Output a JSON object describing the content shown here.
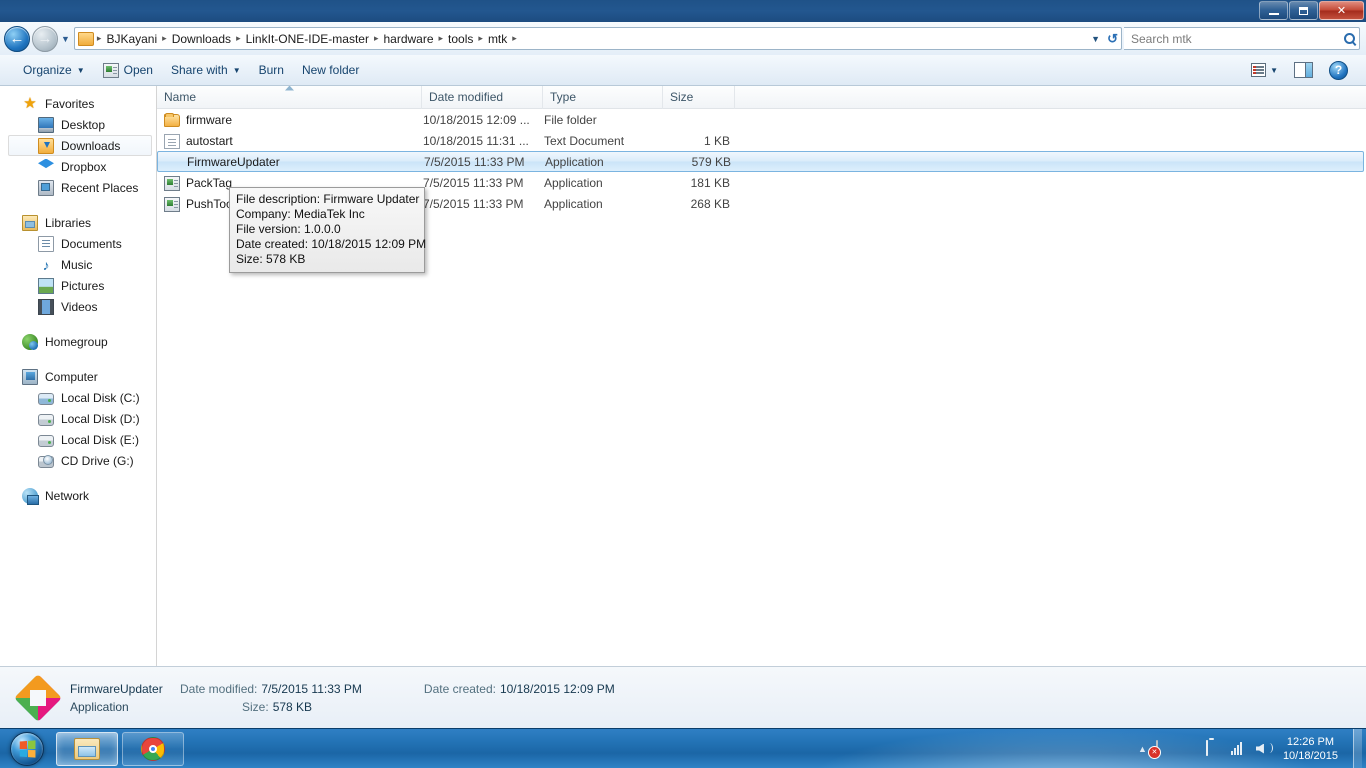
{
  "window": {
    "minimize_label": "Minimize",
    "maximize_label": "Maximize",
    "close_label": "Close"
  },
  "address": {
    "back_glyph": "←",
    "forward_glyph": "→",
    "history_caret": "▼",
    "crumbs": [
      "BJKayani",
      "Downloads",
      "LinkIt-ONE-IDE-master",
      "hardware",
      "tools",
      "mtk"
    ],
    "separator": "▸",
    "dropdown_caret": "▼",
    "refresh_glyph": "↺"
  },
  "search": {
    "placeholder": "Search mtk",
    "value": ""
  },
  "toolbar": {
    "organize_label": "Organize",
    "organize_caret": "▼",
    "open_label": "Open",
    "share_label": "Share with",
    "share_caret": "▼",
    "burn_label": "Burn",
    "new_folder_label": "New folder",
    "view_caret": "▼",
    "help_glyph": "?"
  },
  "sidebar": {
    "groups": [
      {
        "header": "Favorites",
        "items": [
          {
            "label": "Desktop",
            "selected": false
          },
          {
            "label": "Downloads",
            "selected": true
          },
          {
            "label": "Dropbox",
            "selected": false
          },
          {
            "label": "Recent Places",
            "selected": false
          }
        ]
      },
      {
        "header": "Libraries",
        "items": [
          {
            "label": "Documents",
            "selected": false
          },
          {
            "label": "Music",
            "selected": false
          },
          {
            "label": "Pictures",
            "selected": false
          },
          {
            "label": "Videos",
            "selected": false
          }
        ]
      },
      {
        "header": "Homegroup",
        "items": []
      },
      {
        "header": "Computer",
        "items": [
          {
            "label": "Local Disk (C:)",
            "selected": false
          },
          {
            "label": "Local Disk (D:)",
            "selected": false
          },
          {
            "label": "Local Disk (E:)",
            "selected": false
          },
          {
            "label": "CD Drive (G:)",
            "selected": false
          }
        ]
      },
      {
        "header": "Network",
        "items": []
      }
    ]
  },
  "file_list": {
    "columns": [
      "Name",
      "Date modified",
      "Type",
      "Size"
    ],
    "rows": [
      {
        "name": "firmware",
        "date": "10/18/2015 12:09 ...",
        "type": "File folder",
        "size": ""
      },
      {
        "name": "autostart",
        "date": "10/18/2015 11:31 ...",
        "type": "Text Document",
        "size": "1 KB"
      },
      {
        "name": "FirmwareUpdater",
        "date": "7/5/2015 11:33 PM",
        "type": "Application",
        "size": "579 KB"
      },
      {
        "name": "PackTag",
        "date": "7/5/2015 11:33 PM",
        "type": "Application",
        "size": "181 KB"
      },
      {
        "name": "PushTool",
        "date": "7/5/2015 11:33 PM",
        "type": "Application",
        "size": "268 KB"
      }
    ]
  },
  "tooltip": {
    "lines": [
      "File description: Firmware Updater",
      "Company: MediaTek Inc",
      "File version: 1.0.0.0",
      "Date created: 10/18/2015 12:09 PM",
      "Size: 578 KB"
    ]
  },
  "details_pane": {
    "file_name": "FirmwareUpdater",
    "file_type": "Application",
    "date_modified_label": "Date modified:",
    "date_modified_value": "7/5/2015 11:33 PM",
    "date_created_label": "Date created:",
    "date_created_value": "10/18/2015 12:09 PM",
    "size_label": "Size:",
    "size_value": "578 KB"
  },
  "taskbar": {
    "start_label": "Start",
    "buttons": [
      {
        "label": "Windows Explorer",
        "active": true
      },
      {
        "label": "Google Chrome",
        "active": false
      }
    ],
    "tray_expand_glyph": "▲",
    "clock_time": "12:26 PM",
    "clock_date": "10/18/2015"
  },
  "colors": {
    "title_bar": "#23578f",
    "selection_blue": "#cbe4f8",
    "selection_border": "#7bb4e0",
    "taskbar_blue": "#2272b4",
    "accent_orange": "#f0a30a"
  }
}
